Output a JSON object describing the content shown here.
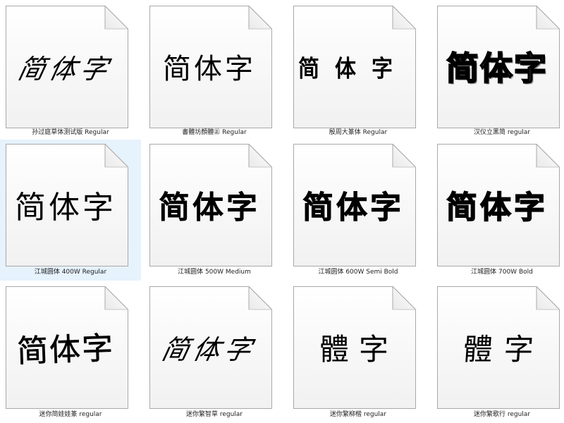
{
  "files": [
    {
      "sample": "简体字",
      "caption": "孙过庭草体测试版 Regular",
      "selected": false,
      "style": "cursive"
    },
    {
      "sample": "简体字",
      "caption": "書體坊顏體㊣ Regular",
      "selected": false,
      "style": "regular"
    },
    {
      "sample": "简体字",
      "caption": "殷周大篆体 Regular",
      "selected": false,
      "style": "seal"
    },
    {
      "sample": "简体字",
      "caption": "汉仪立黑简 regular",
      "selected": false,
      "style": "outline"
    },
    {
      "sample": "简体字",
      "caption": "江城圆体 400W Regular",
      "selected": true,
      "style": "round400"
    },
    {
      "sample": "简体字",
      "caption": "江城圆体 500W Medium",
      "selected": false,
      "style": "round500"
    },
    {
      "sample": "简体字",
      "caption": "江城圆体 600W Semi Bold",
      "selected": false,
      "style": "round600"
    },
    {
      "sample": "简体字",
      "caption": "江城圆体 700W Bold",
      "selected": false,
      "style": "round700"
    },
    {
      "sample": "简体字",
      "caption": "迷你简娃娃篆 regular",
      "selected": false,
      "style": "brush"
    },
    {
      "sample": "简体字",
      "caption": "迷你繁智草 regular",
      "selected": false,
      "style": "cursive"
    },
    {
      "sample": "體字",
      "caption": "迷你繁柳楷 regular",
      "selected": false,
      "style": "kai"
    },
    {
      "sample": "體字",
      "caption": "迷你繁歌行 regular",
      "selected": false,
      "style": "kai2"
    }
  ]
}
